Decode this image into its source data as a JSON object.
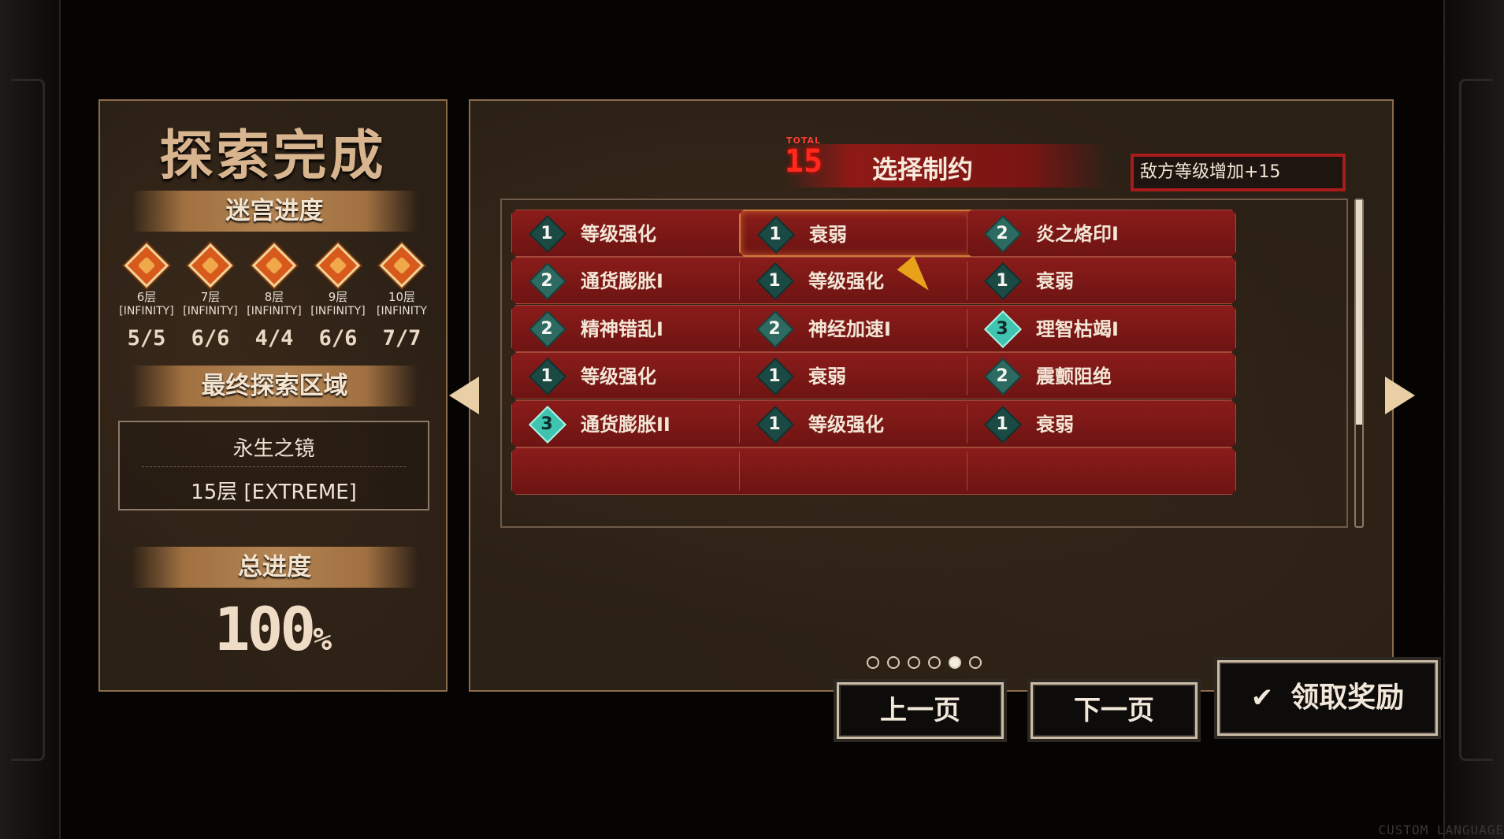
{
  "left_panel": {
    "title": "探索完成",
    "maze_progress_label": "迷宫进度",
    "floors": [
      {
        "name": "6层",
        "mode": "[INFINITY]",
        "count": "5/5"
      },
      {
        "name": "7层",
        "mode": "[INFINITY]",
        "count": "6/6"
      },
      {
        "name": "8层",
        "mode": "[INFINITY]",
        "count": "4/4"
      },
      {
        "name": "9层",
        "mode": "[INFINITY]",
        "count": "6/6"
      },
      {
        "name": "10层",
        "mode": "[INFINITY",
        "count": "7/7"
      }
    ],
    "final_area_label": "最终探索区域",
    "area_name": "永生之镜",
    "area_floor": "15层 [EXTREME]",
    "total_progress_label": "总进度",
    "total_progress_value": "100",
    "total_progress_unit": "%"
  },
  "main_panel": {
    "total_label": "TOTAL",
    "total_value": "15",
    "header_title": "选择制约",
    "effect_text": "敌方等级增加+15",
    "constraints": [
      {
        "level": "1",
        "name": "等级强化",
        "active": false
      },
      {
        "level": "1",
        "name": "衰弱",
        "active": true
      },
      {
        "level": "2",
        "name": "炎之烙印I",
        "active": false
      },
      {
        "level": "2",
        "name": "通货膨胀I",
        "active": false
      },
      {
        "level": "1",
        "name": "等级强化",
        "active": false
      },
      {
        "level": "1",
        "name": "衰弱",
        "active": false
      },
      {
        "level": "2",
        "name": "精神错乱I",
        "active": false
      },
      {
        "level": "2",
        "name": "神经加速I",
        "active": false
      },
      {
        "level": "3",
        "name": "理智枯竭I",
        "active": false
      },
      {
        "level": "1",
        "name": "等级强化",
        "active": false
      },
      {
        "level": "1",
        "name": "衰弱",
        "active": false
      },
      {
        "level": "2",
        "name": "震颤阻绝",
        "active": false
      },
      {
        "level": "3",
        "name": "通货膨胀II",
        "active": false
      },
      {
        "level": "1",
        "name": "等级强化",
        "active": false
      },
      {
        "level": "1",
        "name": "衰弱",
        "active": false
      }
    ],
    "scroll_position": 0.0,
    "page_count": 6,
    "current_page": 5
  },
  "buttons": {
    "prev": "上一页",
    "next": "下一页",
    "claim": "领取奖励"
  },
  "corner_text": "CUSTOM LANGUAGE",
  "colors": {
    "accent_red": "#8e1a17",
    "gem_teal": "#3fc4b0",
    "panel_bg": "#2b2016"
  }
}
